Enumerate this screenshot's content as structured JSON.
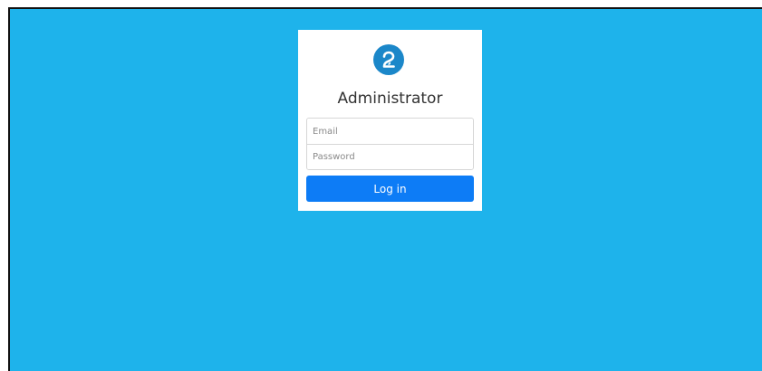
{
  "colors": {
    "background": "#1eb3eb",
    "card": "#ffffff",
    "logo": "#1b87c9",
    "button": "#0d7cf6",
    "button_text": "#ffffff"
  },
  "logo": {
    "icon": "brand-logo-icon"
  },
  "login": {
    "title": "Administrator",
    "email_placeholder": "Email",
    "email_value": "",
    "password_placeholder": "Password",
    "password_value": "",
    "button_label": "Log in"
  }
}
